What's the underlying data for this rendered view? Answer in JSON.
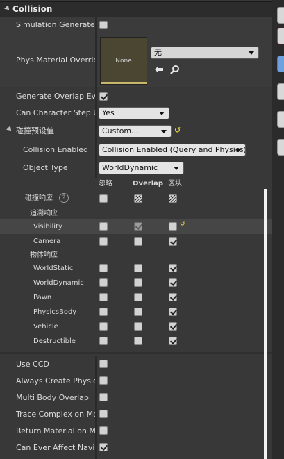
{
  "header": {
    "title": "Collision"
  },
  "props": {
    "sim_hit": "Simulation Generates H",
    "phys_mat": "Phys Material Override",
    "phys_mat_thumb": "None",
    "phys_mat_value": "无",
    "gen_overlap": "Generate Overlap Even",
    "can_step": "Can Character Step Up",
    "can_step_value": "Yes",
    "preset": "碰撞预设值",
    "preset_value": "Custom...",
    "collision_enabled": "Collision Enabled",
    "collision_enabled_value": "Collision Enabled (Query and Physics)",
    "object_type": "Object Type",
    "object_type_value": "WorldDynamic"
  },
  "responses": {
    "col_ignore": "忽略",
    "col_overlap": "Overlap",
    "col_block": "区块",
    "collision_responses": "碰撞响应",
    "help": "?",
    "trace_responses": "追溯响应",
    "object_responses": "物体响应",
    "visibility": "Visibility",
    "camera": "Camera",
    "world_static": "WorldStatic",
    "world_dynamic": "WorldDynamic",
    "pawn": "Pawn",
    "physics_body": "PhysicsBody",
    "vehicle": "Vehicle",
    "destructible": "Destructible"
  },
  "bottom": {
    "use_ccd": "Use CCD",
    "always_create": "Always Create Physics",
    "multi_body": "Multi Body Overlap",
    "trace_complex": "Trace Complex on Mov",
    "return_material": "Return Material on Mov",
    "can_affect": "Can Ever Affect Naviga"
  },
  "icons": {
    "collapse": "collapse-triangle-icon",
    "back": "back-arrow-icon",
    "browse": "magnifier-icon",
    "reset": "reset-to-default-icon"
  },
  "colors": {
    "accent": "#e0d240",
    "panel": "#383838",
    "header": "#2c2c2c"
  }
}
